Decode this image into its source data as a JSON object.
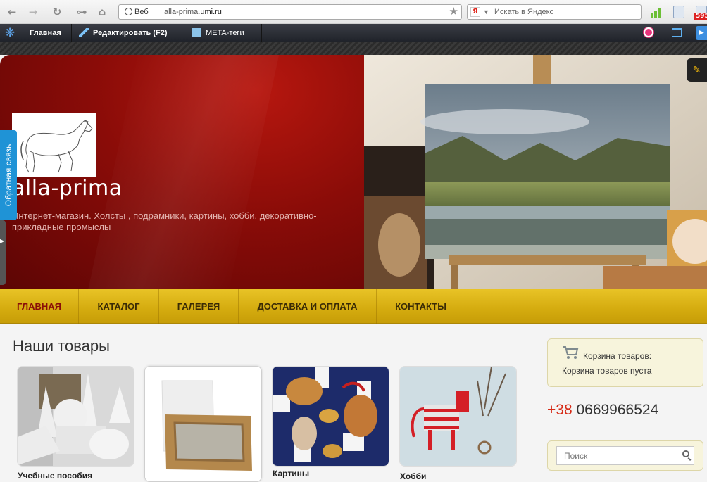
{
  "browser": {
    "back_icon": "arrow-left-icon",
    "address_chip": "Веб",
    "url_prefix": "alla-prima.",
    "url_domain": "umi.ru",
    "search_logo": "Я",
    "search_placeholder": "Искать в Яндекс",
    "badge": "595"
  },
  "admin_bar": {
    "home": "Главная",
    "edit": "Редактировать (F2)",
    "meta": "META-теги"
  },
  "header": {
    "site_title": "alla-prima",
    "site_description": "Интернет-магазин. Холсты , подрамники, картины, хобби, декоративно-прикладные промыслы",
    "feedback_tab": "Обратная связь",
    "colors": {
      "header_red": "#8a0c08",
      "menu_gold": "#d4ab0f",
      "accent_red": "#d62a16"
    }
  },
  "menu": {
    "items": [
      {
        "label": "ГЛАВНАЯ",
        "active": true
      },
      {
        "label": "КАТАЛОГ",
        "active": false
      },
      {
        "label": "ГАЛЕРЕЯ",
        "active": false
      },
      {
        "label": "ДОСТАВКА И ОПЛАТА",
        "active": false
      },
      {
        "label": "КОНТАКТЫ",
        "active": false
      }
    ]
  },
  "main": {
    "section_title": "Наши товары",
    "products": [
      {
        "label": "Учебные пособия"
      },
      {
        "label": ""
      },
      {
        "label": "Картины"
      },
      {
        "label": "Хобби"
      }
    ]
  },
  "sidebar": {
    "cart_title": "Корзина товаров:",
    "cart_empty": "Корзина товаров пуста",
    "phone_code": "+38",
    "phone_number": "0669966524",
    "search_placeholder": "Поиск"
  }
}
